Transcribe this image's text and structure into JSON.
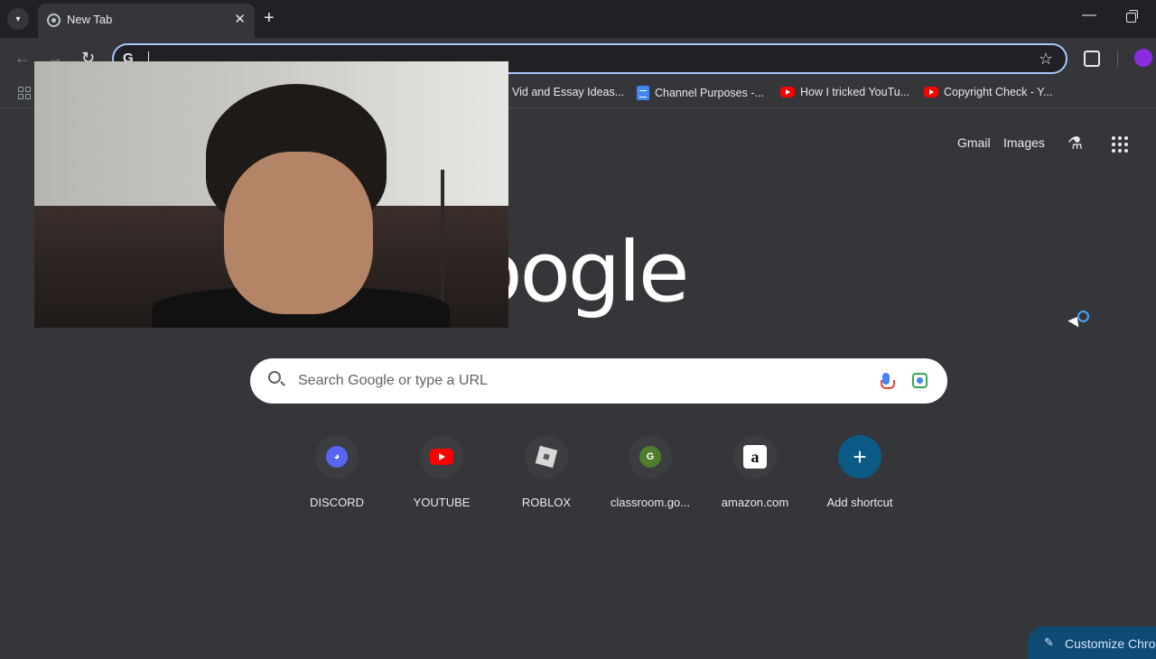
{
  "browser": {
    "tab": {
      "title": "New Tab",
      "close_glyph": "✕"
    },
    "new_tab_glyph": "+",
    "omnibox": {
      "value": ""
    },
    "icons": [
      "tab-search-icon",
      "chrome-favicon-icon",
      "close-icon",
      "plus-icon",
      "minimize-icon",
      "restore-icon",
      "back-icon",
      "forward-icon",
      "reload-icon",
      "google-g-icon",
      "star-icon",
      "extensions-icon",
      "profile-icon",
      "apps-icon"
    ]
  },
  "bookmarks": [
    {
      "label": "Vid and Essay Ideas...",
      "icon": "none"
    },
    {
      "label": "Channel Purposes -...",
      "icon": "docs-icon"
    },
    {
      "label": "How I tricked YouTu...",
      "icon": "youtube-icon"
    },
    {
      "label": "Copyright Check - Y...",
      "icon": "youtube-icon"
    }
  ],
  "ntp": {
    "links": {
      "gmail": "Gmail",
      "images": "Images"
    },
    "logo_text": "Google",
    "search": {
      "placeholder": "Search Google or type a URL"
    },
    "shortcuts": [
      {
        "label": "DISCORD",
        "icon": "discord-icon"
      },
      {
        "label": "YOUTUBE",
        "icon": "youtube-icon"
      },
      {
        "label": "ROBLOX",
        "icon": "roblox-icon"
      },
      {
        "label": "classroom.go...",
        "icon": "classroom-icon",
        "letter": "G"
      },
      {
        "label": "amazon.com",
        "icon": "amazon-icon",
        "letter": "a"
      },
      {
        "label": "Add shortcut",
        "icon": "plus-icon",
        "glyph": "+"
      }
    ],
    "customize_label": "Customize Chrom"
  },
  "colors": {
    "tabstrip": "#202124",
    "toolbar": "#35363a",
    "omnibox_focus": "#a8c7fa",
    "add_shortcut": "#0b5a86",
    "customize_bg": "#0e4b73"
  }
}
